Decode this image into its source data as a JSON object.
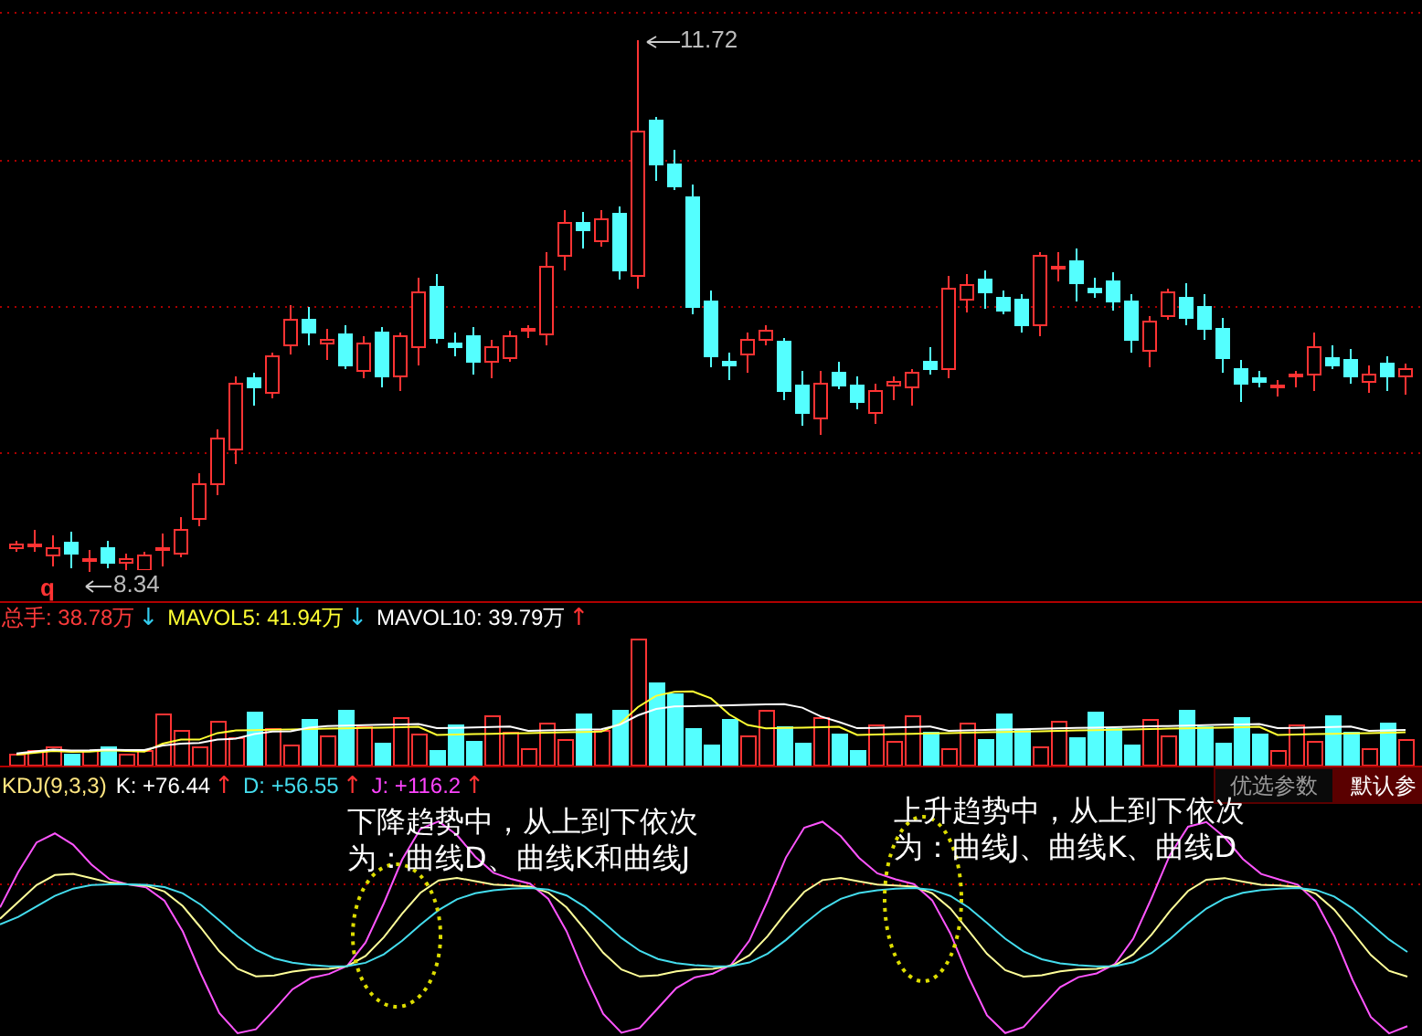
{
  "price_panel": {
    "high_label": "11.72",
    "low_label": "8.34",
    "marker": "q"
  },
  "volume_panel": {
    "legend": [
      {
        "label": "总手: 38.78万",
        "color": "#ff3b3b",
        "rising": false,
        "arrow": "↓"
      },
      {
        "label": "MAVOL5: 41.94万",
        "color": "#ffff33",
        "rising": false,
        "arrow": "↓"
      },
      {
        "label": "MAVOL10: 39.79万",
        "color": "#ffffff",
        "rising": true,
        "arrow": "↑"
      }
    ]
  },
  "kdj_panel": {
    "title": "KDJ(9,3,3)",
    "legend": [
      {
        "label": "K: +76.44",
        "color": "#ffffff",
        "rising": true,
        "arrow": "↑"
      },
      {
        "label": "D: +56.55",
        "color": "#44ddee",
        "rising": true,
        "arrow": "↑"
      },
      {
        "label": "J: +116.2",
        "color": "#ff44ff",
        "rising": true,
        "arrow": "↑"
      }
    ],
    "buttons": [
      {
        "label": "优选参数",
        "selected": false
      },
      {
        "label": "默认参",
        "selected": true
      }
    ],
    "notes": [
      "下降趋势中，从上到下依次为：曲线D、曲线K和曲线J",
      "上升趋势中，从上到下依次为：曲线J、曲线K、曲线D"
    ]
  }
}
